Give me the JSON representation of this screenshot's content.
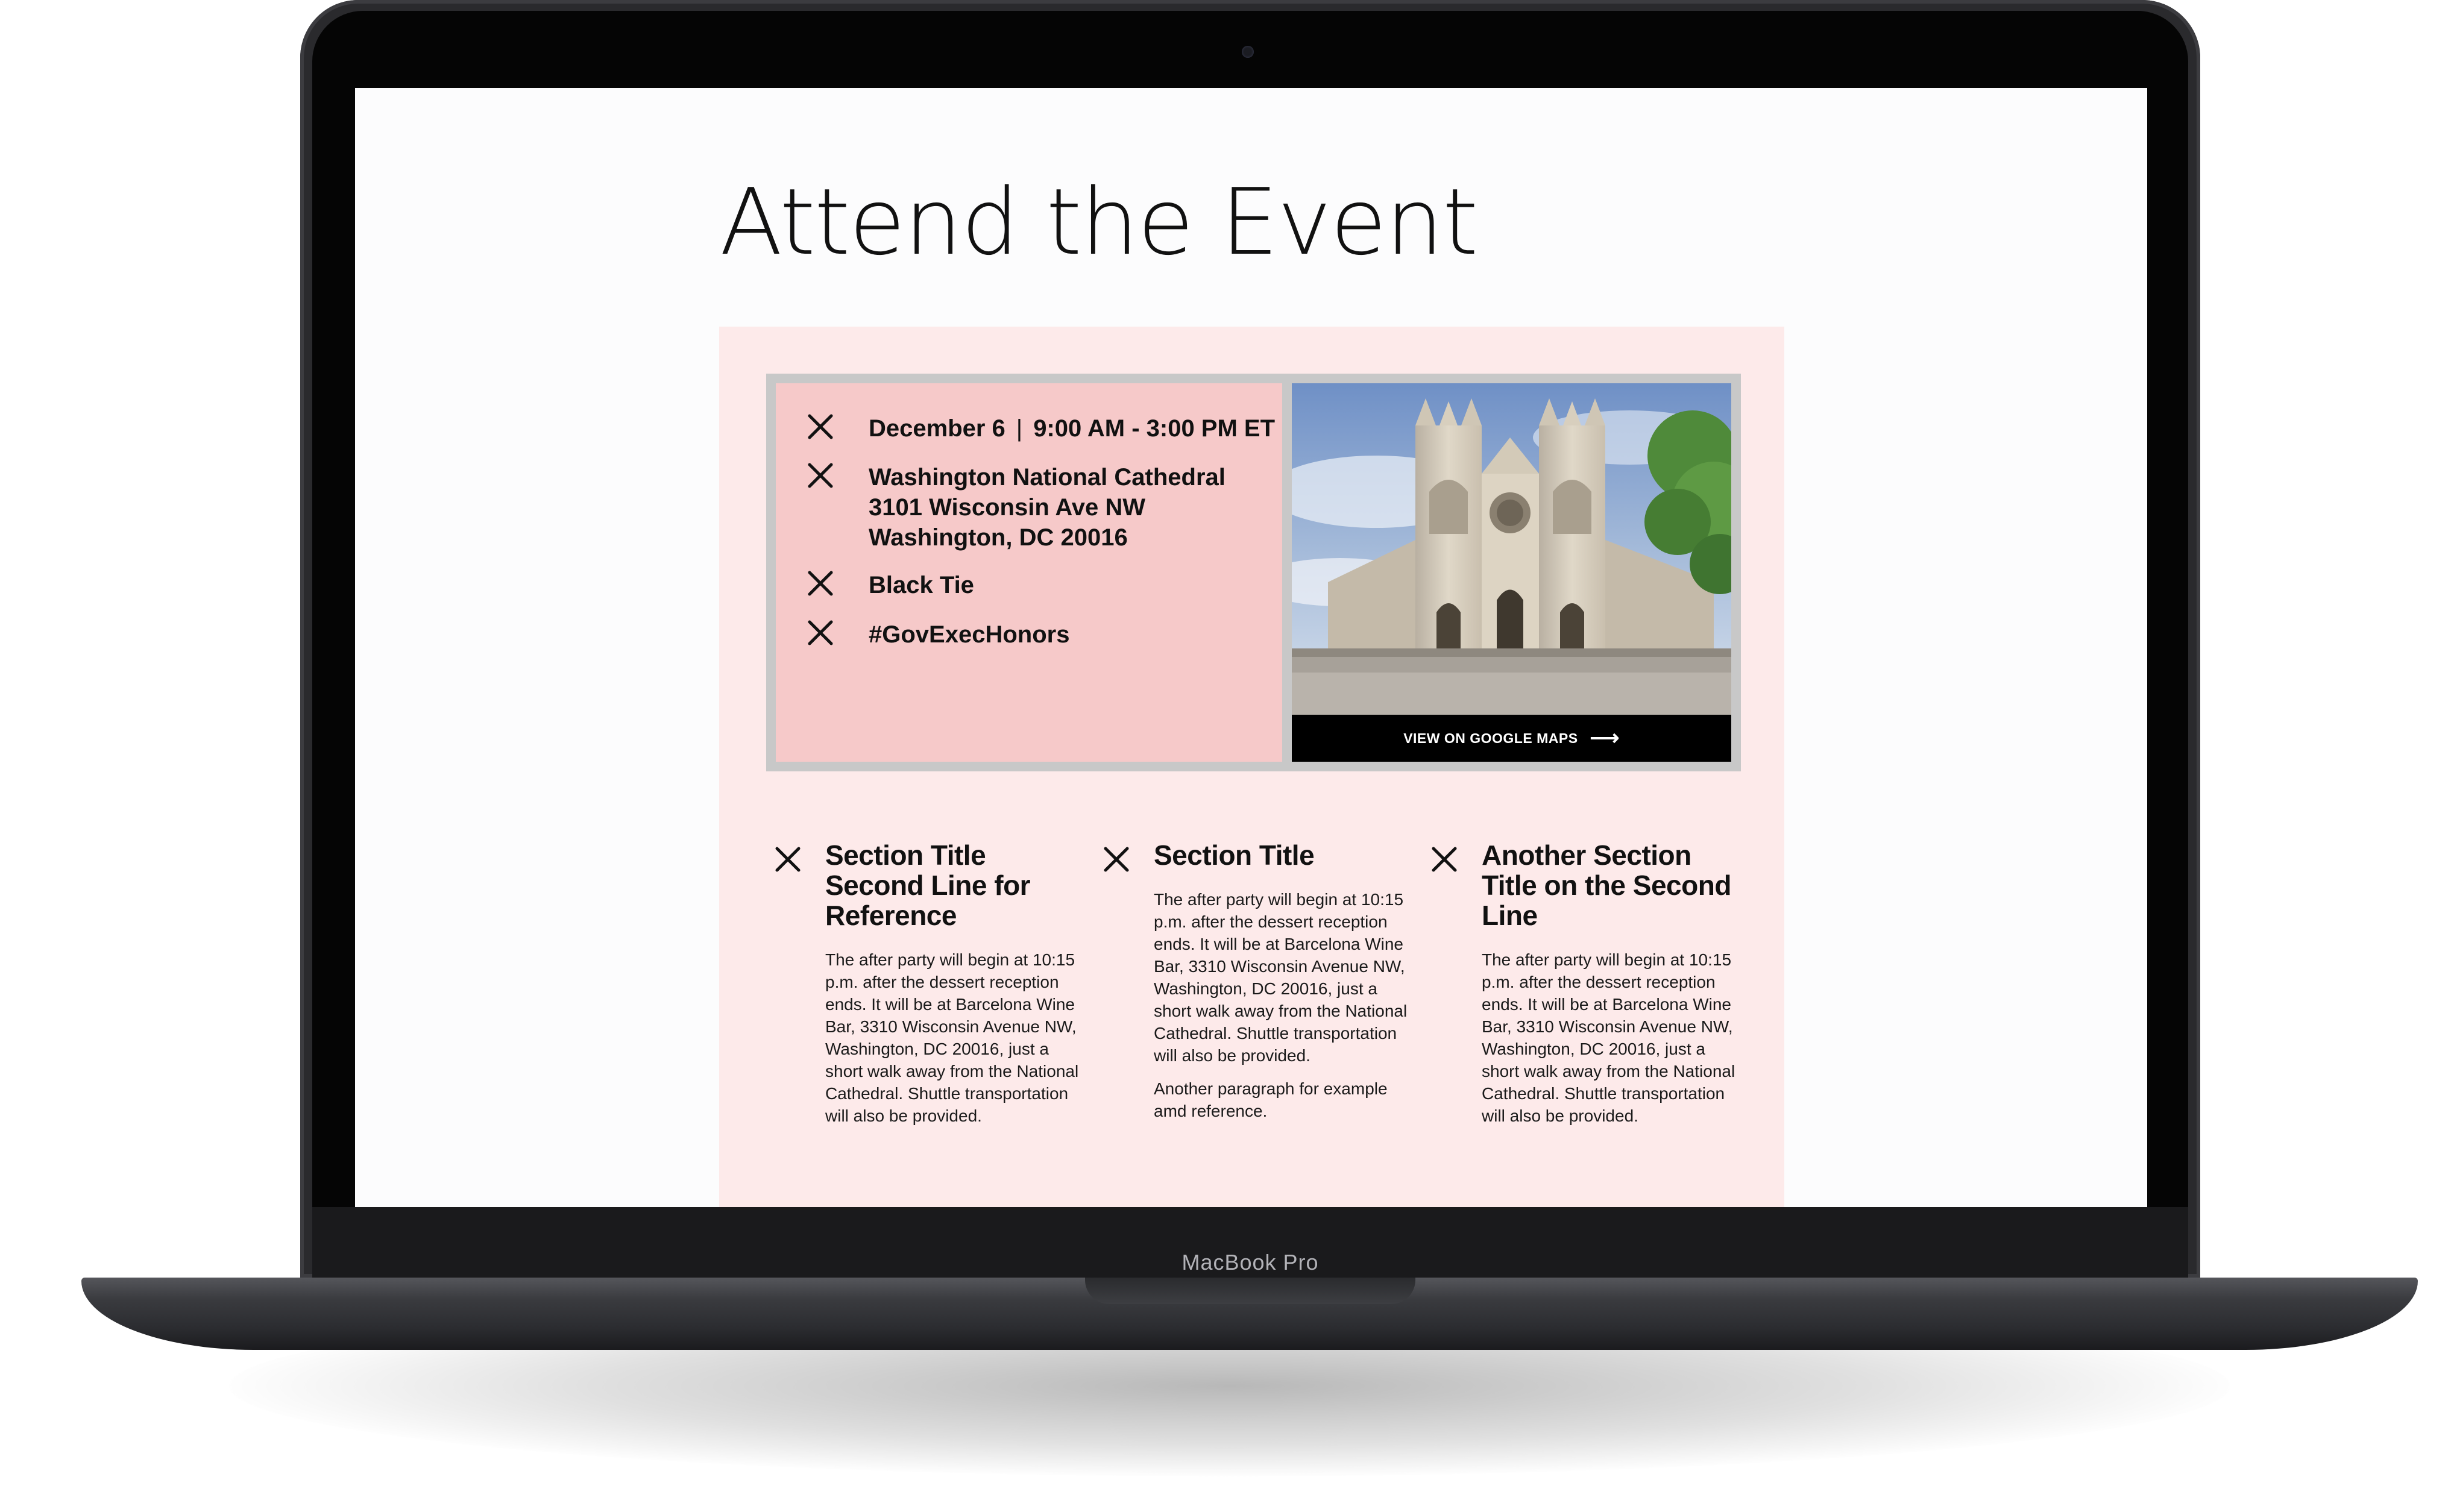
{
  "page": {
    "heading": "Attend the Event"
  },
  "details": {
    "date": "December 6",
    "time": "9:00 AM - 3:00 PM ET",
    "venue_line1": "Washington National Cathedral",
    "venue_line2": "3101 Wisconsin Ave NW",
    "venue_line3": "Washington, DC 20016",
    "dress_code": "Black Tie",
    "hashtag": "#GovExecHonors",
    "icon": "close-x-icon"
  },
  "map": {
    "image_subject": "Washington National Cathedral",
    "link_label": "VIEW ON GOOGLE MAPS",
    "link_icon": "arrow-right-icon"
  },
  "sections": [
    {
      "title": "Section Title Second Line for Reference",
      "paragraphs": [
        "The after party will begin at 10:15 p.m. after the dessert reception ends. It will be at Barcelona Wine Bar, 3310 Wisconsin Avenue NW, Washington, DC 20016, just a short walk away from the National Cathedral. Shuttle transportation will also be provided."
      ]
    },
    {
      "title": "Section Title",
      "paragraphs": [
        "The after party will begin at 10:15 p.m. after the dessert reception ends. It will be at Barcelona Wine Bar, 3310 Wisconsin Avenue NW, Washington, DC 20016, just a short walk away from the National Cathedral. Shuttle transportation will also be provided.",
        "Another paragraph for example amd reference."
      ]
    },
    {
      "title": "Another Section Title on the Second Line",
      "paragraphs": [
        "The after party will begin at 10:15 p.m. after the dessert reception ends. It will be at Barcelona Wine Bar, 3310 Wisconsin Avenue NW, Washington, DC 20016, just a short walk away from the National Cathedral. Shuttle transportation will also be provided."
      ]
    }
  ],
  "device": {
    "label": "MacBook Pro"
  },
  "colors": {
    "panel_background": "#fdeaea",
    "info_background": "#f6c9c9",
    "card_border": "#c8c8c8",
    "map_bar": "#000000",
    "text": "#111111"
  }
}
